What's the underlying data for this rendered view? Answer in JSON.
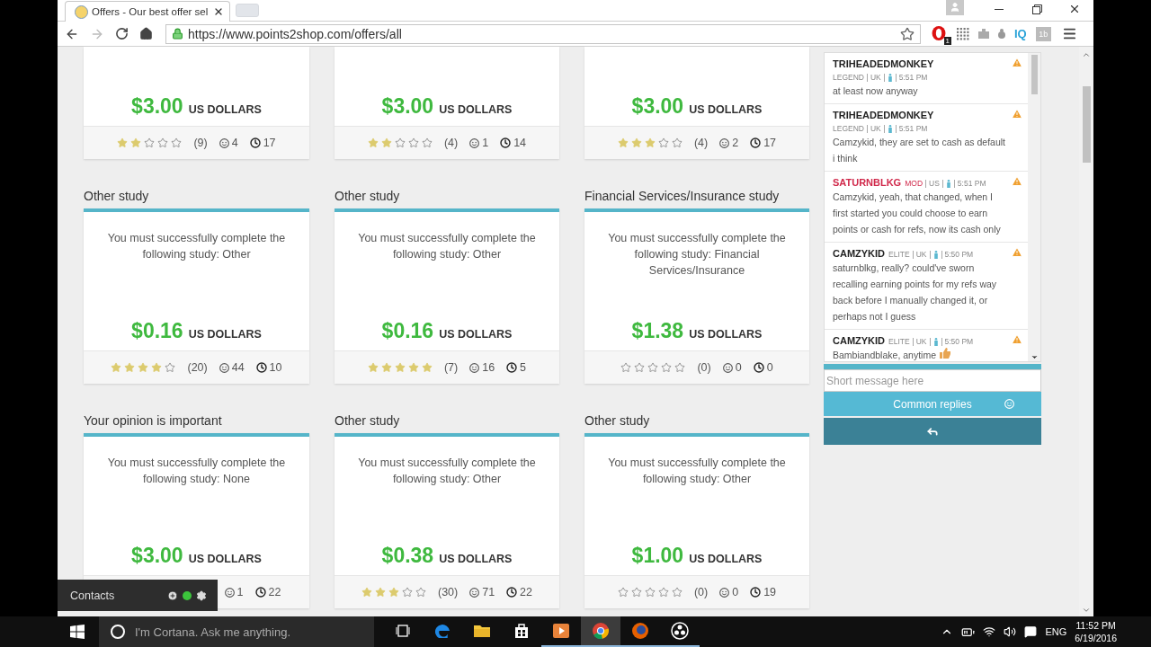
{
  "browser": {
    "tab": {
      "title": "Offers - Our best offer sel",
      "selected": true
    },
    "url": "https://www.points2shop.com/offers/all",
    "forward_disabled": true,
    "extensions": [
      {
        "kind": "opera",
        "badge": "1"
      },
      {
        "kind": "grid"
      },
      {
        "kind": "puzzle"
      },
      {
        "kind": "bug"
      },
      {
        "kind": "iq",
        "label": "IQ"
      },
      {
        "kind": "tile",
        "label": "1b"
      }
    ]
  },
  "offers": [
    {
      "price": "$3.00",
      "currency": "US DOLLARS",
      "stars": 2,
      "reviews": "(9)",
      "smiles": "4",
      "hours": "17"
    },
    {
      "price": "$3.00",
      "currency": "US DOLLARS",
      "stars": 2,
      "reviews": "(4)",
      "smiles": "1",
      "hours": "14"
    },
    {
      "price": "$3.00",
      "currency": "US DOLLARS",
      "stars": 3,
      "reviews": "(4)",
      "smiles": "2",
      "hours": "17"
    },
    {
      "title": "Other study",
      "description": "You must successfully complete the following study: Other",
      "price": "$0.16",
      "currency": "US DOLLARS",
      "stars": 4,
      "reviews": "(20)",
      "smiles": "44",
      "hours": "10"
    },
    {
      "title": "Other study",
      "description": "You must successfully complete the following study: Other",
      "price": "$0.16",
      "currency": "US DOLLARS",
      "stars": 5,
      "reviews": "(7)",
      "smiles": "16",
      "hours": "5"
    },
    {
      "title": "Financial Services/Insurance study",
      "description": "You must successfully complete the following study: Financial Services/Insurance",
      "price": "$1.38",
      "currency": "US DOLLARS",
      "stars": 0,
      "reviews": "(0)",
      "smiles": "0",
      "hours": "0"
    },
    {
      "title": "Your opinion is important",
      "description": "You must successfully complete the following study: None",
      "price": "$3.00",
      "currency": "US DOLLARS",
      "smiles": "1",
      "hours": "22"
    },
    {
      "title": "Other study",
      "description": "You must successfully complete the following study: Other",
      "price": "$0.38",
      "currency": "US DOLLARS",
      "stars": 3,
      "reviews": "(30)",
      "smiles": "71",
      "hours": "22"
    },
    {
      "title": "Other study",
      "description": "You must successfully complete the following study: Other",
      "price": "$1.00",
      "currency": "US DOLLARS",
      "stars": 0,
      "reviews": "(0)",
      "smiles": "0",
      "hours": "19"
    }
  ],
  "contacts": {
    "label": "Contacts",
    "online": true
  },
  "chat": {
    "messages": [
      {
        "name": "TRIHEADEDMONKEY",
        "moderator": false,
        "rank": "LEGEND",
        "country": "UK",
        "time": "5:51 PM",
        "text": "at least now anyway"
      },
      {
        "name": "TRIHEADEDMONKEY",
        "moderator": false,
        "rank": "LEGEND",
        "country": "UK",
        "time": "5:51 PM",
        "text": "Camzykid, they are set to cash as default i think"
      },
      {
        "name": "SATURNBLKG",
        "moderator": true,
        "rank": "MOD",
        "country": "US",
        "time": "5:51 PM",
        "text": "Camzykid, yeah, that changed, when I first started you could choose to earn points or cash for refs, now its cash only"
      },
      {
        "name": "CAMZYKID",
        "moderator": false,
        "rank": "ELITE",
        "country": "UK",
        "time": "5:50 PM",
        "text": "saturnblkg, really? could've sworn recalling earning points for my refs way back before I manually changed it, or perhaps not I guess"
      },
      {
        "name": "CAMZYKID",
        "moderator": false,
        "rank": "ELITE",
        "country": "UK",
        "time": "5:50 PM",
        "text": "Bambiandblake, anytime",
        "emoji": true
      }
    ],
    "input": {
      "placeholder": "Short message here"
    },
    "replies_button": "Common replies"
  },
  "taskbar": {
    "search": {
      "placeholder": "I'm Cortana. Ask me anything."
    },
    "apps": [
      {
        "kind": "taskview",
        "running": false,
        "selected": false
      },
      {
        "kind": "edge",
        "running": false,
        "selected": false
      },
      {
        "kind": "explorer",
        "running": false,
        "selected": false
      },
      {
        "kind": "store",
        "running": false,
        "selected": false
      },
      {
        "kind": "media",
        "running": true,
        "selected": false
      },
      {
        "kind": "chrome",
        "running": true,
        "selected": true
      },
      {
        "kind": "firefox",
        "running": true,
        "selected": false
      },
      {
        "kind": "obs",
        "running": true,
        "selected": false
      }
    ],
    "language": "ENG",
    "time": "11:52 PM",
    "date": "6/19/2016"
  }
}
